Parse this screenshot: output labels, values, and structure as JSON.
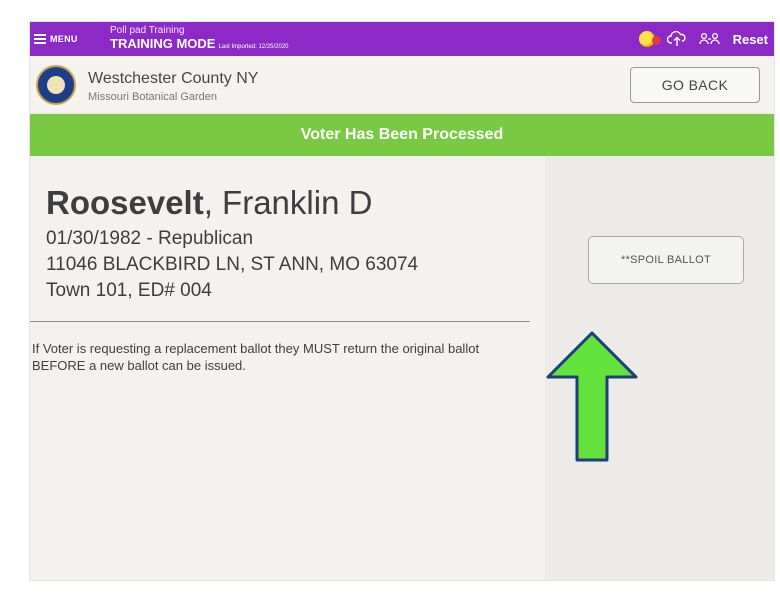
{
  "topbar": {
    "menu_label": "MENU",
    "title_line1": "Poll pad Training",
    "title_line2": "TRAINING MODE",
    "last_imported": "Last Imported: 12/25/2020",
    "reset_label": "Reset",
    "icons": [
      "hamburger-icon",
      "status-indicator-icon",
      "cloud-upload-icon",
      "users-icon"
    ]
  },
  "header": {
    "county": "Westchester County NY",
    "location": "Missouri Botanical Garden",
    "go_back_label": "GO BACK"
  },
  "banner": {
    "text": "Voter Has Been Processed",
    "color": "#7ac943"
  },
  "voter": {
    "surname": "Roosevelt",
    "given_names": ", Franklin D",
    "dob_party": "01/30/1982 - Republican",
    "address": "11046 BLACKBIRD LN, ST ANN, MO 63074",
    "district": "Town 101, ED# 004"
  },
  "notice": "If Voter is requesting a replacement ballot they MUST return the original ballot BEFORE a new ballot can be issued.",
  "actions": {
    "spoil_ballot_label": "**SPOIL BALLOT"
  },
  "colors": {
    "topbar": "#8b2ac6",
    "arrow_fill": "#62e23a",
    "arrow_outline": "#1f3d7a"
  }
}
